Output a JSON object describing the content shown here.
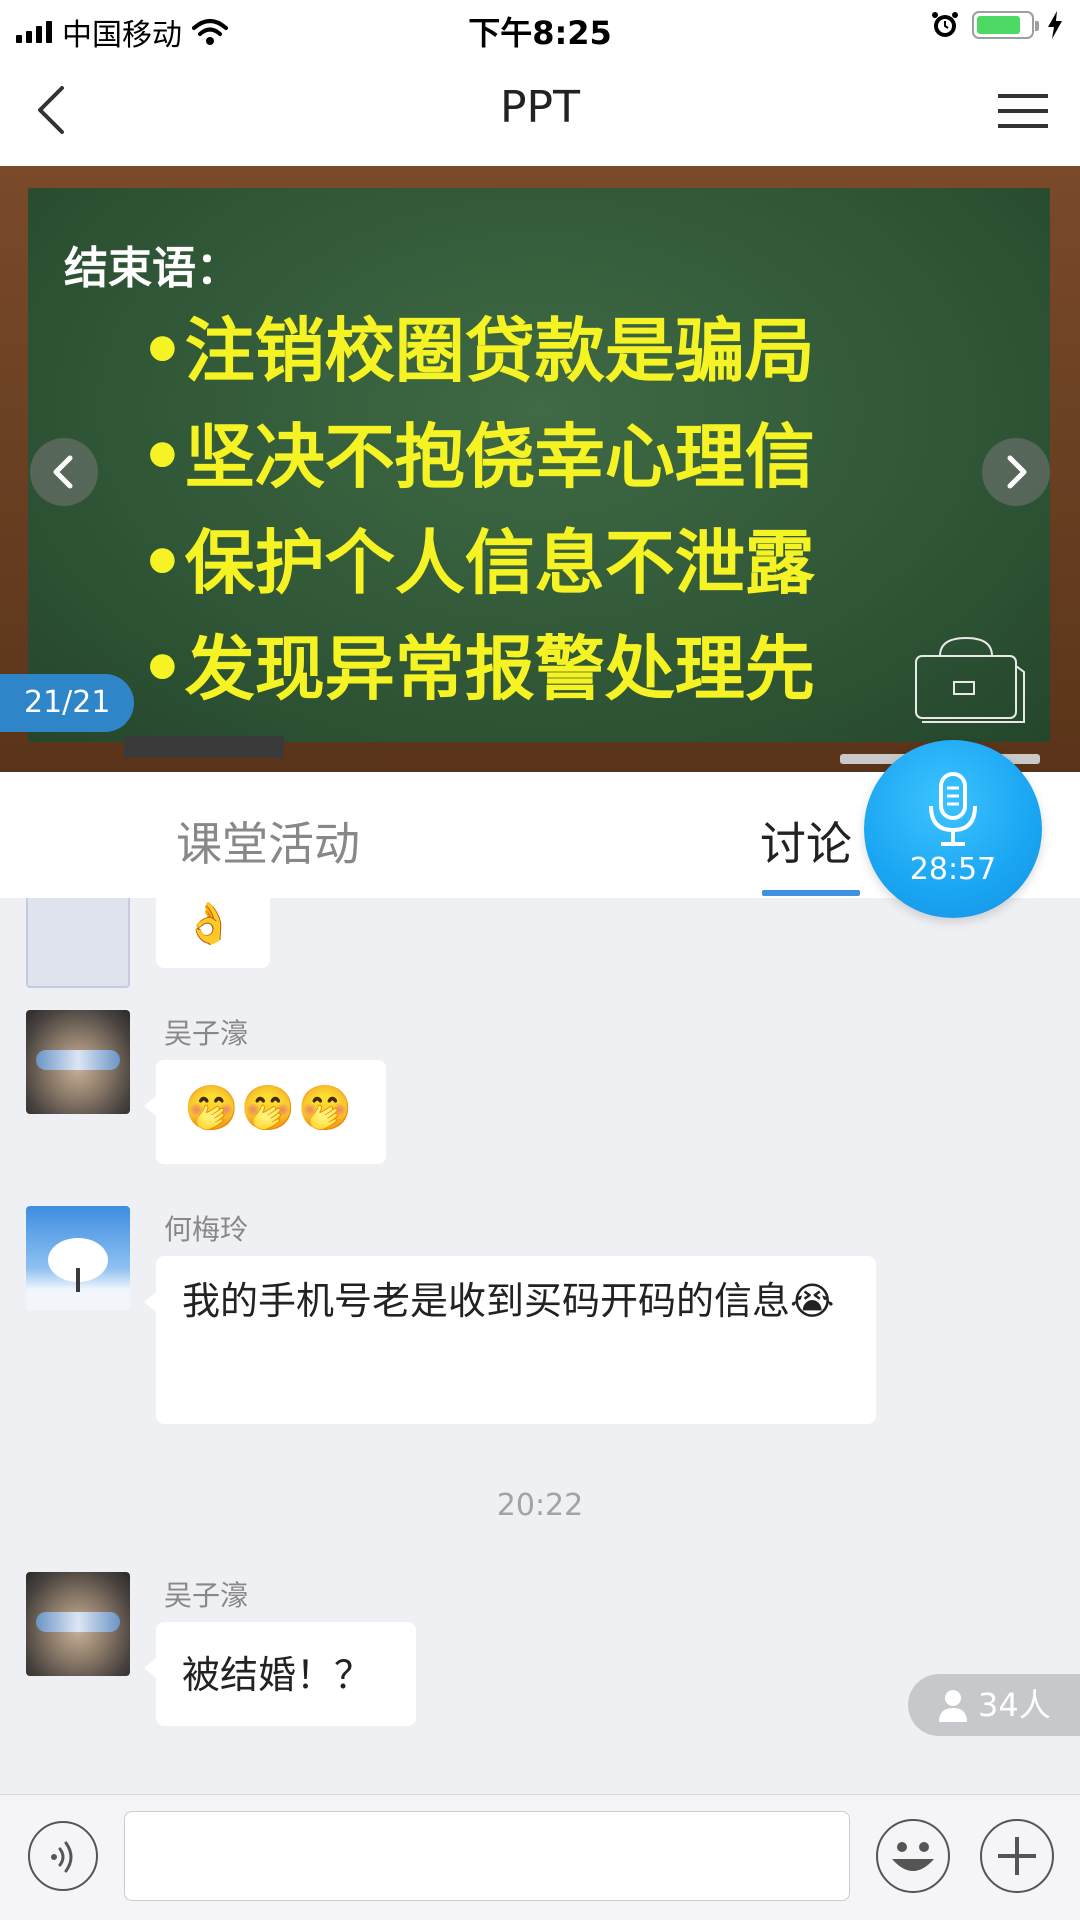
{
  "status_bar": {
    "carrier": "中国移动",
    "time": "下午8:25",
    "battery_level": 0.8,
    "battery_color": "#4cd964"
  },
  "nav": {
    "title": "PPT",
    "back_icon": "chevron-left-icon",
    "menu_icon": "hamburger-menu-icon"
  },
  "slide": {
    "heading": "结束语：",
    "lines": [
      "•注销校圈贷款是骗局",
      "•坚决不抱侥幸心理信",
      "•保护个人信息不泄露",
      "•发现异常报警处理先"
    ],
    "page_indicator": "21/21",
    "text_color": "#f5f323"
  },
  "tabs": {
    "activity_label": "课堂活动",
    "discussion_label": "讨论",
    "active_color": "#3f90e0"
  },
  "mic": {
    "timer": "28:57",
    "color": "#1aa5f2"
  },
  "chat": {
    "messages": [
      {
        "sender": "",
        "text": "👌"
      },
      {
        "sender": "吴子濠",
        "text": "🤭🤭🤭"
      },
      {
        "sender": "何梅玲",
        "text": "我的手机号老是收到买码开码的信息😭"
      },
      {
        "sender": "吴子濠",
        "text": "被结婚！？"
      }
    ],
    "time_separator": "20:22",
    "online_count": "34人"
  },
  "input_bar": {
    "value": "",
    "voice_icon": "voice-icon",
    "emoji_icon": "emoji-icon",
    "plus_icon": "plus-icon"
  }
}
